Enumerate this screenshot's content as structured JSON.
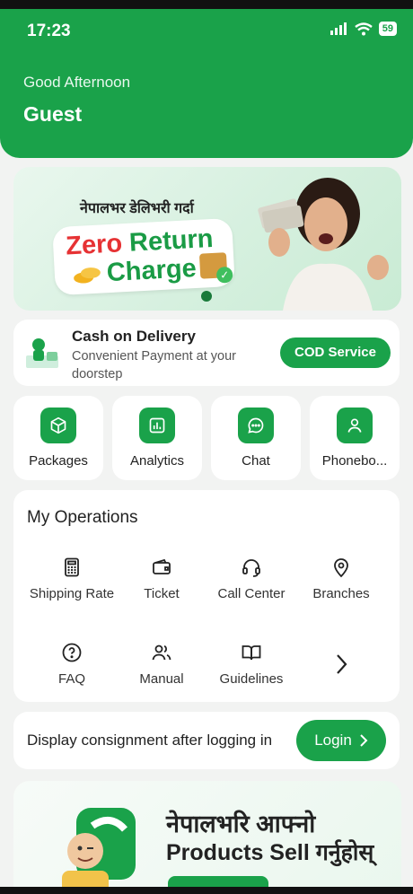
{
  "status": {
    "time": "17:23",
    "battery": "59"
  },
  "header": {
    "greeting": "Good Afternoon",
    "user": "Guest"
  },
  "banner": {
    "devanagari_line": "नेपालभर डेलिभरी गर्दा",
    "zero": "Zero",
    "return": "Return",
    "charge": "Charge"
  },
  "cod": {
    "title": "Cash on Delivery",
    "subtitle": "Convenient Payment at your doorstep",
    "button": "COD Service"
  },
  "quick_actions": [
    {
      "label": "Packages",
      "icon": "box-icon"
    },
    {
      "label": "Analytics",
      "icon": "bar-chart-icon"
    },
    {
      "label": "Chat",
      "icon": "chat-icon"
    },
    {
      "label": "Phonebo...",
      "icon": "person-icon"
    }
  ],
  "operations": {
    "title": "My Operations",
    "items": [
      {
        "label": "Shipping Rate",
        "icon": "calculator-icon"
      },
      {
        "label": "Ticket",
        "icon": "ticket-icon"
      },
      {
        "label": "Call Center",
        "icon": "headset-icon"
      },
      {
        "label": "Branches",
        "icon": "location-pin-icon"
      },
      {
        "label": "FAQ",
        "icon": "question-icon"
      },
      {
        "label": "Manual",
        "icon": "users-icon"
      },
      {
        "label": "Guidelines",
        "icon": "book-icon"
      }
    ]
  },
  "login_prompt": {
    "text": "Display consignment after logging in",
    "button": "Login"
  },
  "promo": {
    "line1": "नेपालभरि आफ्नो",
    "line2": "Products Sell गर्नुहोस्"
  },
  "colors": {
    "brand_green": "#1aa24a",
    "red": "#e63234"
  }
}
